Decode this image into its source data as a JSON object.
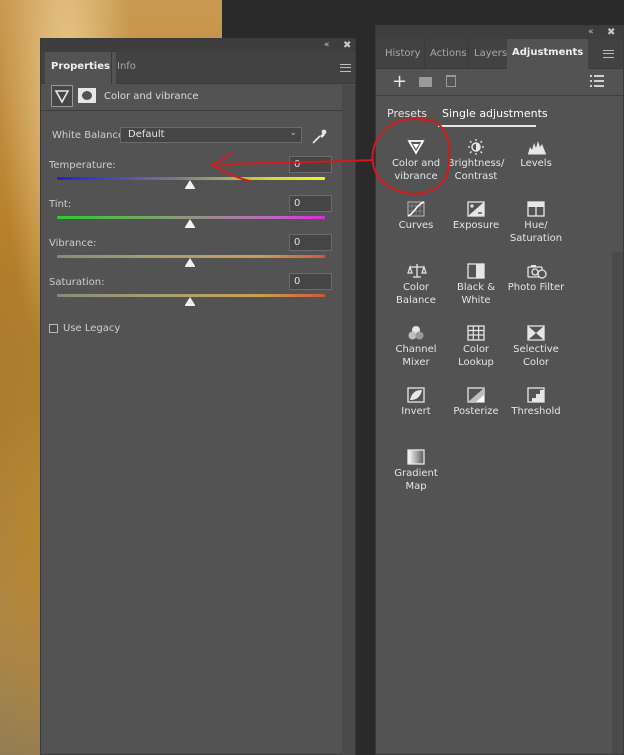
{
  "properties": {
    "tabs": [
      "Properties",
      "Info"
    ],
    "header_title": "Color and vibrance",
    "white_balance": {
      "label": "White Balance:",
      "value": "Default"
    },
    "sliders": [
      {
        "label": "Temperature:",
        "value": "0"
      },
      {
        "label": "Tint:",
        "value": "0"
      },
      {
        "label": "Vibrance:",
        "value": "0"
      },
      {
        "label": "Saturation:",
        "value": "0"
      }
    ],
    "use_legacy": "Use Legacy"
  },
  "adjustments": {
    "tabs": [
      "History",
      "Actions",
      "Layers",
      "Adjustments"
    ],
    "subtabs": [
      "Presets",
      "Single adjustments"
    ],
    "items": [
      {
        "label": "Color and\nvibrance",
        "icon": "vibrance-icon"
      },
      {
        "label": "Brightness/\nContrast",
        "icon": "brightness-contrast-icon"
      },
      {
        "label": "Levels",
        "icon": "levels-icon"
      },
      {
        "label": "Curves",
        "icon": "curves-icon"
      },
      {
        "label": "Exposure",
        "icon": "exposure-icon"
      },
      {
        "label": "Hue/\nSaturation",
        "icon": "hue-saturation-icon"
      },
      {
        "label": "Color\nBalance",
        "icon": "color-balance-icon"
      },
      {
        "label": "Black &\nWhite",
        "icon": "black-white-icon"
      },
      {
        "label": "Photo Filter",
        "icon": "photo-filter-icon"
      },
      {
        "label": "Channel\nMixer",
        "icon": "channel-mixer-icon"
      },
      {
        "label": "Color\nLookup",
        "icon": "color-lookup-icon"
      },
      {
        "label": "Selective\nColor",
        "icon": "selective-color-icon"
      },
      {
        "label": "Invert",
        "icon": "invert-icon"
      },
      {
        "label": "Posterize",
        "icon": "posterize-icon"
      },
      {
        "label": "Threshold",
        "icon": "threshold-icon"
      },
      {
        "label": "Gradient\nMap",
        "icon": "gradient-map-icon"
      }
    ]
  },
  "colors": {
    "annotation": "#d11a1a",
    "panel": "#535353",
    "tab_underline": "#e6e6e6"
  }
}
